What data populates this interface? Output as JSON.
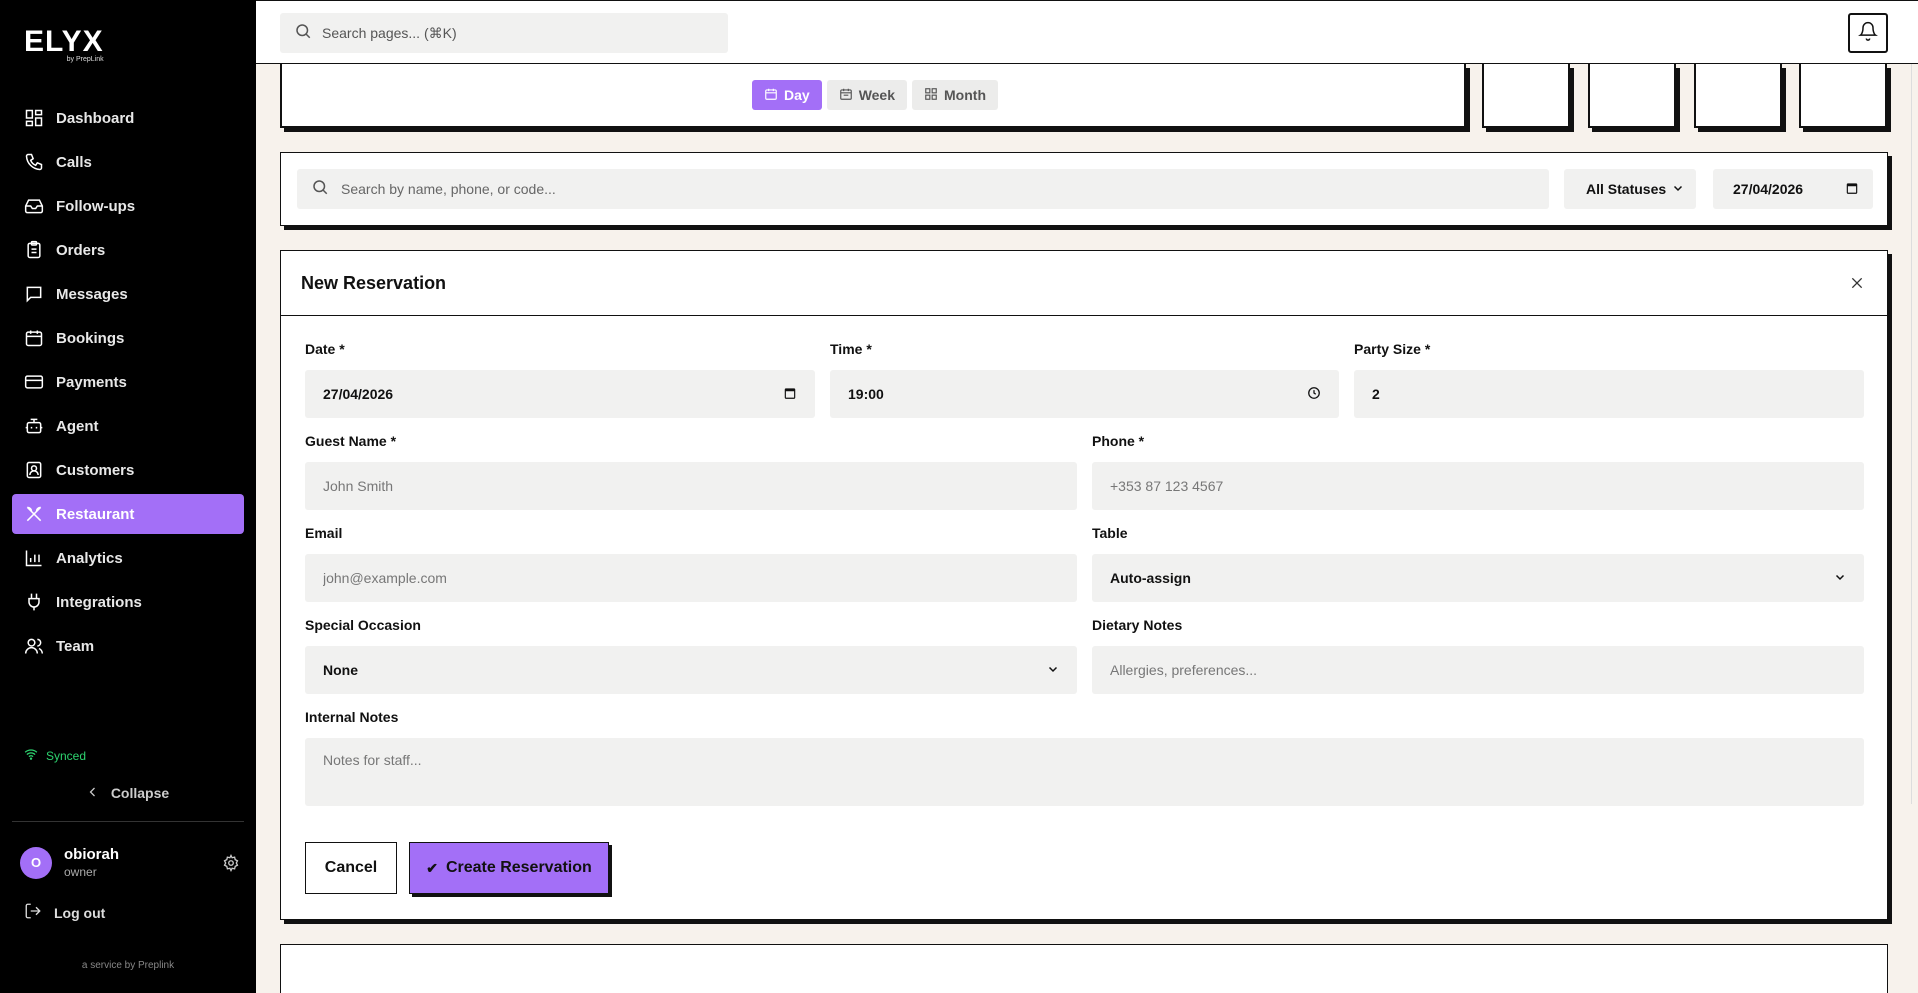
{
  "brand": {
    "logo": "ELYX",
    "sub": "by PrepLink"
  },
  "sidebar": {
    "items": [
      {
        "label": "Dashboard",
        "icon": "grid-icon"
      },
      {
        "label": "Calls",
        "icon": "phone-icon"
      },
      {
        "label": "Follow-ups",
        "icon": "inbox-icon"
      },
      {
        "label": "Orders",
        "icon": "clipboard-icon"
      },
      {
        "label": "Messages",
        "icon": "message-icon"
      },
      {
        "label": "Bookings",
        "icon": "calendar-icon"
      },
      {
        "label": "Payments",
        "icon": "credit-card-icon"
      },
      {
        "label": "Agent",
        "icon": "bot-icon"
      },
      {
        "label": "Customers",
        "icon": "contact-icon"
      },
      {
        "label": "Restaurant",
        "icon": "utensils-icon",
        "active": true
      },
      {
        "label": "Analytics",
        "icon": "bar-chart-icon"
      },
      {
        "label": "Integrations",
        "icon": "plug-icon"
      },
      {
        "label": "Team",
        "icon": "users-icon"
      }
    ],
    "synced": "Synced",
    "collapse": "Collapse",
    "user": {
      "initial": "O",
      "name": "obiorah",
      "role": "owner"
    },
    "logout": "Log out",
    "service": "a service by Preplink"
  },
  "topbar": {
    "search_placeholder": "Search pages... (⌘K)"
  },
  "view_toggle": {
    "day": "Day",
    "week": "Week",
    "month": "Month",
    "active": "Day"
  },
  "filters": {
    "search_placeholder": "Search by name, phone, or code...",
    "status": "All Statuses",
    "date": "27/04/2026"
  },
  "reservation": {
    "title": "New Reservation",
    "date_label": "Date *",
    "date_value": "27/04/2026",
    "time_label": "Time *",
    "time_value": "19:00",
    "party_label": "Party Size *",
    "party_value": "2",
    "guest_label": "Guest Name *",
    "guest_placeholder": "John Smith",
    "phone_label": "Phone *",
    "phone_placeholder": "+353 87 123 4567",
    "email_label": "Email",
    "email_placeholder": "john@example.com",
    "table_label": "Table",
    "table_value": "Auto-assign",
    "occasion_label": "Special Occasion",
    "occasion_value": "None",
    "dietary_label": "Dietary Notes",
    "dietary_placeholder": "Allergies, preferences...",
    "internal_label": "Internal Notes",
    "internal_placeholder": "Notes for staff...",
    "cancel": "Cancel",
    "create": "Create Reservation"
  },
  "colors": {
    "accent": "#a36ff7",
    "sidebar_bg": "#000000",
    "page_bg": "#f7f2ec",
    "synced": "#2dd36f"
  }
}
